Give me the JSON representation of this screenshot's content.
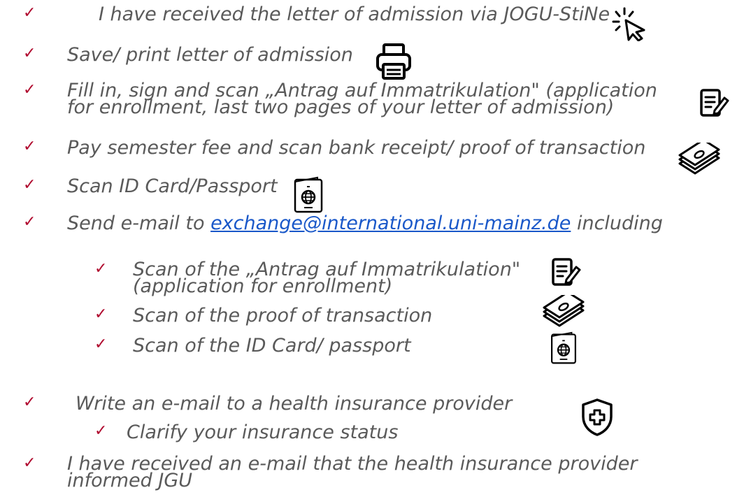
{
  "check_symbol": "✓",
  "items": {
    "i1": "I have received the letter of admission via JOGU-StiNe",
    "i2": "Save/ print letter of admission",
    "i3_l1": "Fill in, sign and scan „Antrag auf Immatrikulation\" (application",
    "i3_l2": "for enrollment, last two pages of your letter of admission)",
    "i4": "Pay semester fee and scan bank receipt/ proof of transaction",
    "i5": "Scan ID Card/Passport",
    "i6_before": "Send e-mail to ",
    "i6_link": "exchange@international.uni-mainz.de",
    "i6_after": " including",
    "s1_l1": "Scan of the „Antrag auf Immatrikulation\"",
    "s1_l2": "(application for enrollment)",
    "s2": "Scan of the proof of transaction",
    "s3": "Scan of the ID Card/ passport",
    "i7": "Write an e-mail to a health insurance provider",
    "s4": "Clarify your insurance status",
    "i8_l1": "I have received an e-mail that the health insurance provider",
    "i8_l2": "informed JGU"
  },
  "icons": [
    "cursor-click-icon",
    "printer-icon",
    "document-edit-icon",
    "money-stack-icon",
    "passport-icon",
    "shield-plus-icon"
  ],
  "colors": {
    "check": "#b00a2e",
    "text": "#5a5a5a",
    "link": "#1a58c9"
  }
}
